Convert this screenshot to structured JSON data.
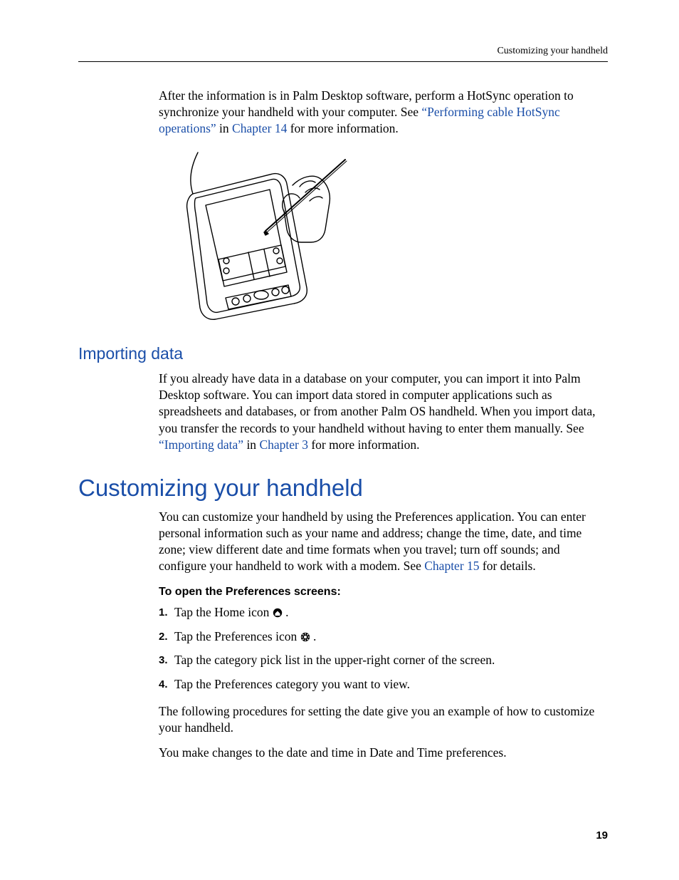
{
  "header": {
    "running_head": "Customizing your handheld"
  },
  "intro": {
    "para1_a": "After the information is in Palm Desktop software, perform a HotSync operation to synchronize your handheld with your computer. See ",
    "link1": "“Performing cable HotSync operations”",
    "para1_b": " in ",
    "link2": "Chapter 14",
    "para1_c": " for more information."
  },
  "importing": {
    "heading": "Importing data",
    "para_a": "If you already have data in a database on your computer, you can import it into Palm Desktop software. You can import data stored in computer applications such as spreadsheets and databases, or from another Palm OS handheld. When you import data, you transfer the records to your handheld without having to enter them manually. See ",
    "link1": "“Importing data”",
    "para_b": " in ",
    "link2": "Chapter 3",
    "para_c": " for more information."
  },
  "custom": {
    "heading": "Customizing your handheld",
    "para_a": "You can customize your handheld by using the Preferences application. You can enter personal information such as your name and address; change the time, date, and time zone; view different date and time formats when you travel; turn off sounds; and configure your handheld to work with a modem. See ",
    "link1": "Chapter 15",
    "para_b": " for details.",
    "proc_title": "To open the Preferences screens:",
    "steps": [
      {
        "n": "1.",
        "t_a": "Tap the Home icon ",
        "t_b": "."
      },
      {
        "n": "2.",
        "t_a": "Tap the Preferences icon ",
        "t_b": "."
      },
      {
        "n": "3.",
        "t_a": "Tap the category pick list in the upper-right corner of the screen.",
        "t_b": ""
      },
      {
        "n": "4.",
        "t_a": "Tap the Preferences category you want to view.",
        "t_b": ""
      }
    ],
    "after1": "The following procedures for setting the date give you an example of how to customize your handheld.",
    "after2": "You make changes to the date and time in Date and Time preferences."
  },
  "page_number": "19"
}
